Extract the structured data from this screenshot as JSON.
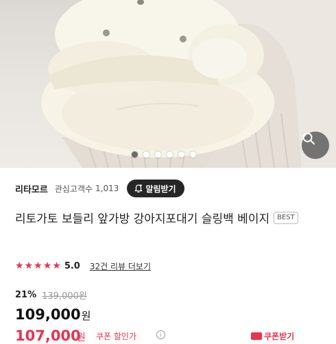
{
  "hero": {
    "image_alt": "product photo: cream quilted dog-face sling bag",
    "active_index": 0,
    "dot_count": 5
  },
  "store": {
    "name": "리타모르",
    "followers_label": "관심고객수",
    "followers_count": "1,013",
    "alert_button": "알림받기"
  },
  "product": {
    "title": "리토가토 보들리 앞가방 강아지포대기 슬링백 베이지",
    "badge": "BEST"
  },
  "rating": {
    "score": "5.0",
    "stars": 5,
    "review_link": "32건 리뷰 더보기"
  },
  "price": {
    "discount": "21%",
    "original": "139,000원",
    "current": "109,000",
    "unit": "원"
  },
  "coupon": {
    "price": "107,000",
    "unit": "원",
    "label": "쿠폰 할인가",
    "info_icon": "i",
    "button": "쿠폰받기"
  },
  "colors": {
    "accent": "#e8344e",
    "dark": "#262626"
  }
}
